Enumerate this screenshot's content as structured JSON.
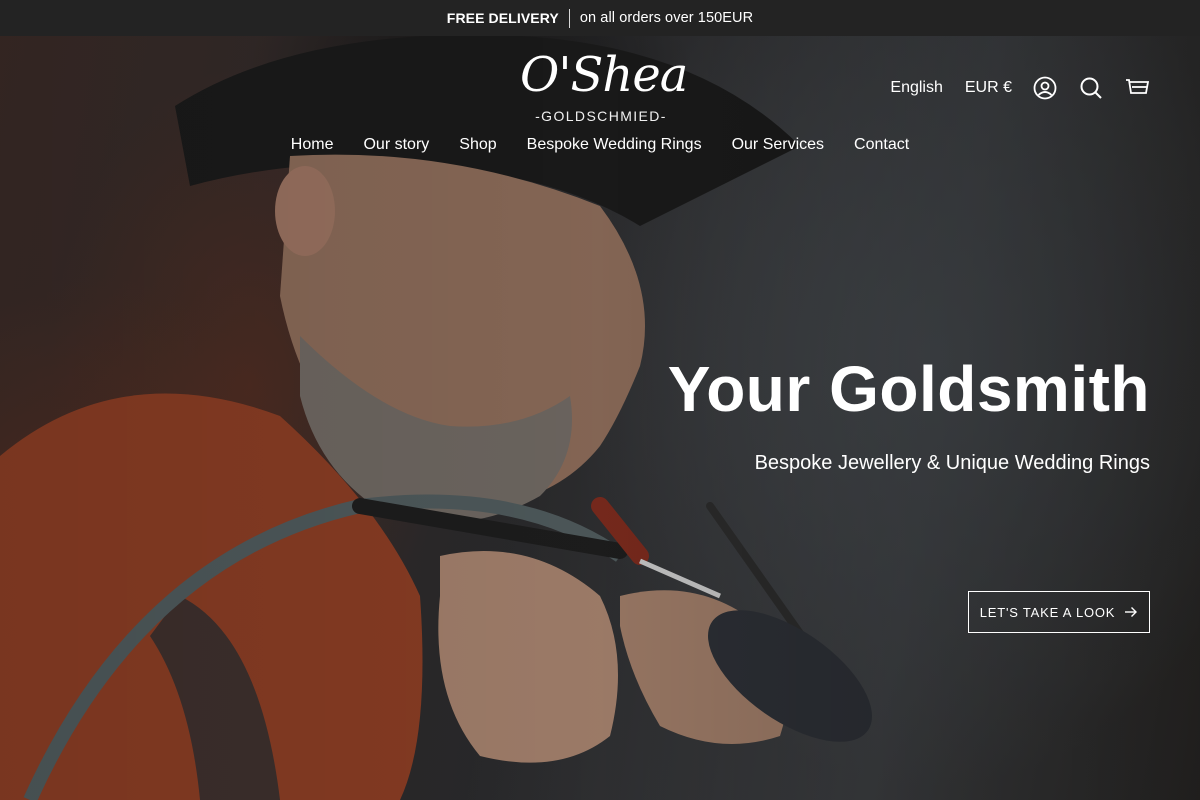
{
  "announcement": {
    "highlight": "FREE DELIVERY",
    "text": "on all orders over 150EUR"
  },
  "brand": {
    "name": "O'Shea",
    "tagline": "-GOLDSCHMIED-"
  },
  "utility": {
    "language": "English",
    "currency": "EUR €",
    "icons": [
      "account-icon",
      "search-icon",
      "cart-icon"
    ]
  },
  "nav": {
    "items": [
      {
        "label": "Home"
      },
      {
        "label": "Our story"
      },
      {
        "label": "Shop"
      },
      {
        "label": "Bespoke Wedding Rings"
      },
      {
        "label": "Our Services"
      },
      {
        "label": "Contact"
      }
    ]
  },
  "hero": {
    "title": "Your Goldsmith",
    "subtitle": "Bespoke Jewellery & Unique Wedding Rings",
    "cta_label": "LET'S TAKE A LOOK"
  },
  "colors": {
    "announcement_bg": "#232323",
    "text": "#ffffff"
  }
}
